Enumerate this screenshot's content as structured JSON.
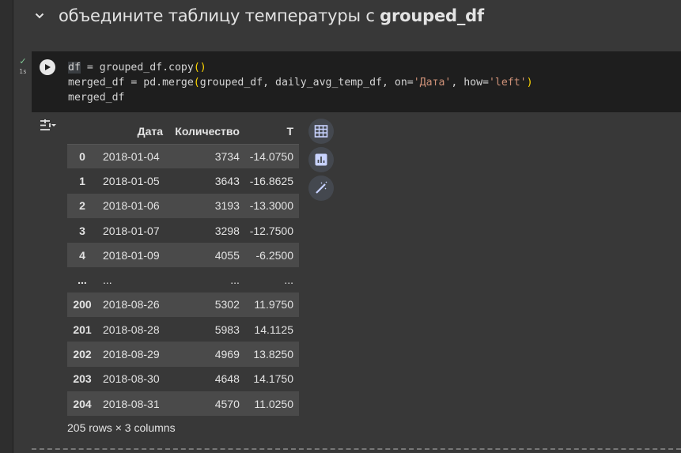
{
  "markdown": {
    "title_plain": "объедините таблицу температуры с ",
    "title_bold": "grouped_df"
  },
  "cell": {
    "exec_time": "1s",
    "code": {
      "l1_var": "df",
      "l1_rest": " = grouped_df.copy",
      "l2_a": "merged_df = pd.merge",
      "l2_b": "grouped_df, daily_avg_temp_df, on=",
      "l2_str1": "'Дата'",
      "l2_c": ", how=",
      "l2_str2": "'left'",
      "l3": "merged_df"
    }
  },
  "table": {
    "columns": [
      "Дата",
      "Количество",
      "T"
    ],
    "rows": [
      {
        "idx": "0",
        "date": "2018-01-04",
        "count": "3734",
        "t": "-14.0750"
      },
      {
        "idx": "1",
        "date": "2018-01-05",
        "count": "3643",
        "t": "-16.8625"
      },
      {
        "idx": "2",
        "date": "2018-01-06",
        "count": "3193",
        "t": "-13.3000"
      },
      {
        "idx": "3",
        "date": "2018-01-07",
        "count": "3298",
        "t": "-12.7500"
      },
      {
        "idx": "4",
        "date": "2018-01-09",
        "count": "4055",
        "t": "-6.2500"
      },
      {
        "idx": "...",
        "date": "...",
        "count": "...",
        "t": "..."
      },
      {
        "idx": "200",
        "date": "2018-08-26",
        "count": "5302",
        "t": "11.9750"
      },
      {
        "idx": "201",
        "date": "2018-08-28",
        "count": "5983",
        "t": "14.1125"
      },
      {
        "idx": "202",
        "date": "2018-08-29",
        "count": "4969",
        "t": "13.8250"
      },
      {
        "idx": "203",
        "date": "2018-08-30",
        "count": "4648",
        "t": "14.1750"
      },
      {
        "idx": "204",
        "date": "2018-08-31",
        "count": "4570",
        "t": "11.0250"
      }
    ],
    "footer": "205 rows × 3 columns"
  },
  "icons": {
    "collapse": "chevron-down-icon",
    "run": "play-icon",
    "status": "check-icon",
    "output_menu": "output-options-icon",
    "table_view": "table-icon",
    "chart": "chart-icon",
    "magic": "magic-wand-icon"
  },
  "colors": {
    "background": "#383838",
    "code_bg": "#1e1e1e",
    "string": "#ce9178",
    "bracket": "#ffd700",
    "check": "#81c995"
  }
}
